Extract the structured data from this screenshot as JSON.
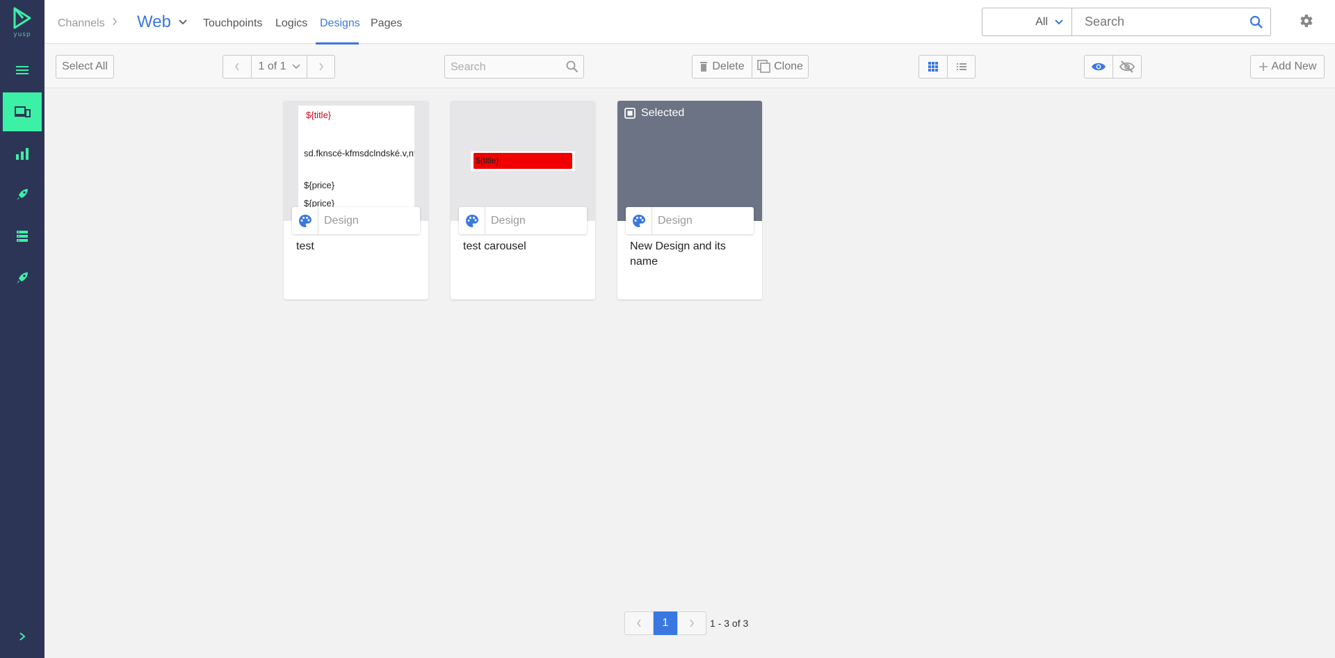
{
  "brand": {
    "logo_text": "yusp"
  },
  "sidebar": {
    "items": [
      {
        "icon": "hamburger-icon"
      },
      {
        "icon": "devices-icon",
        "active": true
      },
      {
        "icon": "bar-chart-icon"
      },
      {
        "icon": "rocket-icon"
      },
      {
        "icon": "server-icon"
      },
      {
        "icon": "rocket-icon"
      }
    ]
  },
  "header": {
    "breadcrumb": "Channels",
    "channel": "Web",
    "tabs": [
      "Touchpoints",
      "Logics",
      "Designs",
      "Pages"
    ],
    "active_tab": "Designs",
    "scope_value": "All",
    "search_placeholder": "Search"
  },
  "toolbar": {
    "select_all": "Select All",
    "page_indicator": "1 of 1",
    "search_placeholder": "Search",
    "delete": "Delete",
    "clone": "Clone",
    "add_new": "Add New"
  },
  "cards": [
    {
      "name": "test",
      "tag": "Design",
      "preview": {
        "title": "${title}",
        "description": "sd.fknscé-kfmsdclndské.v,nfsdé.,vm",
        "price1": "${price}",
        "price2": "${price}"
      }
    },
    {
      "name": "test carousel",
      "tag": "Design",
      "preview": {
        "title": "${title}"
      }
    },
    {
      "name": "New Design and its name",
      "tag": "Design",
      "selected_label": "Selected"
    }
  ],
  "pagination": {
    "current": "1",
    "summary": "1 - 3 of 3"
  },
  "colors": {
    "sidebar": "#2d3557",
    "accent": "#3b77e0",
    "active_green": "#3cf0a5"
  }
}
